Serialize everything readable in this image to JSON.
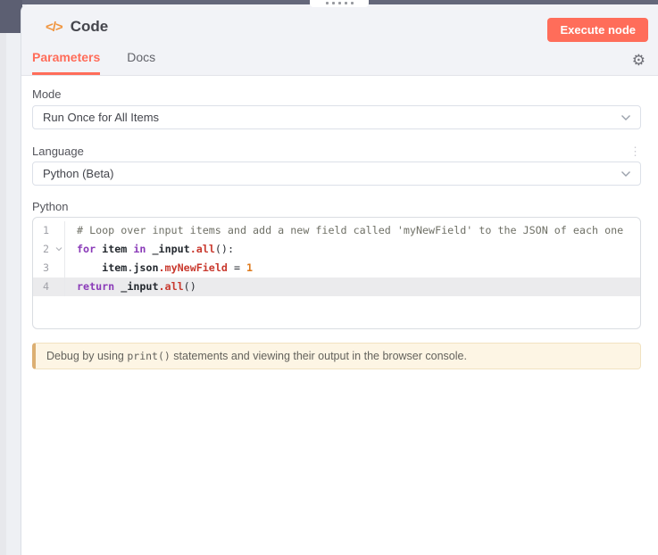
{
  "header": {
    "icon_glyph": "</>",
    "title": "Code",
    "execute_button": "Execute node",
    "tabs": [
      {
        "label": "Parameters",
        "active": true
      },
      {
        "label": "Docs",
        "active": false
      }
    ]
  },
  "parameters": {
    "mode": {
      "label": "Mode",
      "value": "Run Once for All Items"
    },
    "language": {
      "label": "Language",
      "value": "Python (Beta)"
    },
    "editor": {
      "label": "Python",
      "language": "python",
      "lines": [
        {
          "number": 1,
          "tokens": [
            {
              "t": "comment",
              "v": "# Loop over input items and add a new field called 'myNewField' to the JSON of each one"
            }
          ]
        },
        {
          "number": 2,
          "fold": true,
          "tokens": [
            {
              "t": "keyword",
              "v": "for"
            },
            {
              "t": "plain",
              "v": " "
            },
            {
              "t": "variable",
              "v": "item"
            },
            {
              "t": "plain",
              "v": " "
            },
            {
              "t": "keyword",
              "v": "in"
            },
            {
              "t": "plain",
              "v": " "
            },
            {
              "t": "variable",
              "v": "_input"
            },
            {
              "t": "property",
              "v": ".all"
            },
            {
              "t": "plain",
              "v": "():"
            }
          ]
        },
        {
          "number": 3,
          "tokens": [
            {
              "t": "plain",
              "v": "    "
            },
            {
              "t": "variable",
              "v": "item"
            },
            {
              "t": "plain",
              "v": "."
            },
            {
              "t": "variable",
              "v": "json"
            },
            {
              "t": "property",
              "v": ".myNewField"
            },
            {
              "t": "plain",
              "v": " = "
            },
            {
              "t": "number",
              "v": "1"
            }
          ]
        },
        {
          "number": 4,
          "active": true,
          "tokens": [
            {
              "t": "keyword",
              "v": "return"
            },
            {
              "t": "plain",
              "v": " "
            },
            {
              "t": "variable",
              "v": "_input"
            },
            {
              "t": "property",
              "v": ".all"
            },
            {
              "t": "plain",
              "v": "()"
            }
          ]
        }
      ]
    },
    "notice": {
      "prefix": "Debug by using ",
      "code": "print()",
      "suffix": " statements and viewing their output in the browser console."
    }
  },
  "colors": {
    "accent": "#ff6d5a",
    "node_icon": "#f0953f",
    "header_bg": "#f2f3f7",
    "active_line_bg": "#ebebed",
    "keyword": "#8a3ab8",
    "property": "#c9392e",
    "number": "#de7a1d",
    "comment": "#6f7066",
    "notice_bg": "#fdf5e4",
    "notice_border": "#dcaf72"
  }
}
